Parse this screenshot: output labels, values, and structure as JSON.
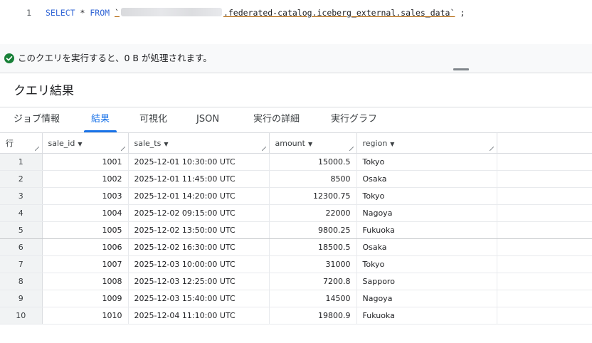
{
  "editor": {
    "line_number": "1",
    "keyword_select": "SELECT",
    "star": "*",
    "keyword_from": "FROM",
    "backtick_open": "`",
    "table_path": ".federated-catalog.iceberg_external.sales_data",
    "backtick_close": "`",
    "semicolon": ";"
  },
  "validation": {
    "message": "このクエリを実行すると、0 B が処理されます。",
    "status_color": "#188038"
  },
  "results": {
    "title": "クエリ結果"
  },
  "tabs": [
    {
      "label": "ジョブ情報"
    },
    {
      "label": "結果"
    },
    {
      "label": "可視化"
    },
    {
      "label": "JSON"
    },
    {
      "label": "実行の詳細"
    },
    {
      "label": "実行グラフ"
    }
  ],
  "active_tab": "結果",
  "table": {
    "columns": [
      {
        "label": "行"
      },
      {
        "label": "sale_id"
      },
      {
        "label": "sale_ts"
      },
      {
        "label": "amount"
      },
      {
        "label": "region"
      }
    ],
    "rows": [
      {
        "row": "1",
        "sale_id": "1001",
        "sale_ts": "2025-12-01 10:30:00 UTC",
        "amount": "15000.5",
        "region": "Tokyo"
      },
      {
        "row": "2",
        "sale_id": "1002",
        "sale_ts": "2025-12-01 11:45:00 UTC",
        "amount": "8500",
        "region": "Osaka"
      },
      {
        "row": "3",
        "sale_id": "1003",
        "sale_ts": "2025-12-01 14:20:00 UTC",
        "amount": "12300.75",
        "region": "Tokyo"
      },
      {
        "row": "4",
        "sale_id": "1004",
        "sale_ts": "2025-12-02 09:15:00 UTC",
        "amount": "22000",
        "region": "Nagoya"
      },
      {
        "row": "5",
        "sale_id": "1005",
        "sale_ts": "2025-12-02 13:50:00 UTC",
        "amount": "9800.25",
        "region": "Fukuoka"
      },
      {
        "row": "6",
        "sale_id": "1006",
        "sale_ts": "2025-12-02 16:30:00 UTC",
        "amount": "18500.5",
        "region": "Osaka"
      },
      {
        "row": "7",
        "sale_id": "1007",
        "sale_ts": "2025-12-03 10:00:00 UTC",
        "amount": "31000",
        "region": "Tokyo"
      },
      {
        "row": "8",
        "sale_id": "1008",
        "sale_ts": "2025-12-03 12:25:00 UTC",
        "amount": "7200.8",
        "region": "Sapporo"
      },
      {
        "row": "9",
        "sale_id": "1009",
        "sale_ts": "2025-12-03 15:40:00 UTC",
        "amount": "14500",
        "region": "Nagoya"
      },
      {
        "row": "10",
        "sale_id": "1010",
        "sale_ts": "2025-12-04 11:10:00 UTC",
        "amount": "19800.9",
        "region": "Fukuoka"
      }
    ]
  },
  "accent_color": "#1a73e8"
}
